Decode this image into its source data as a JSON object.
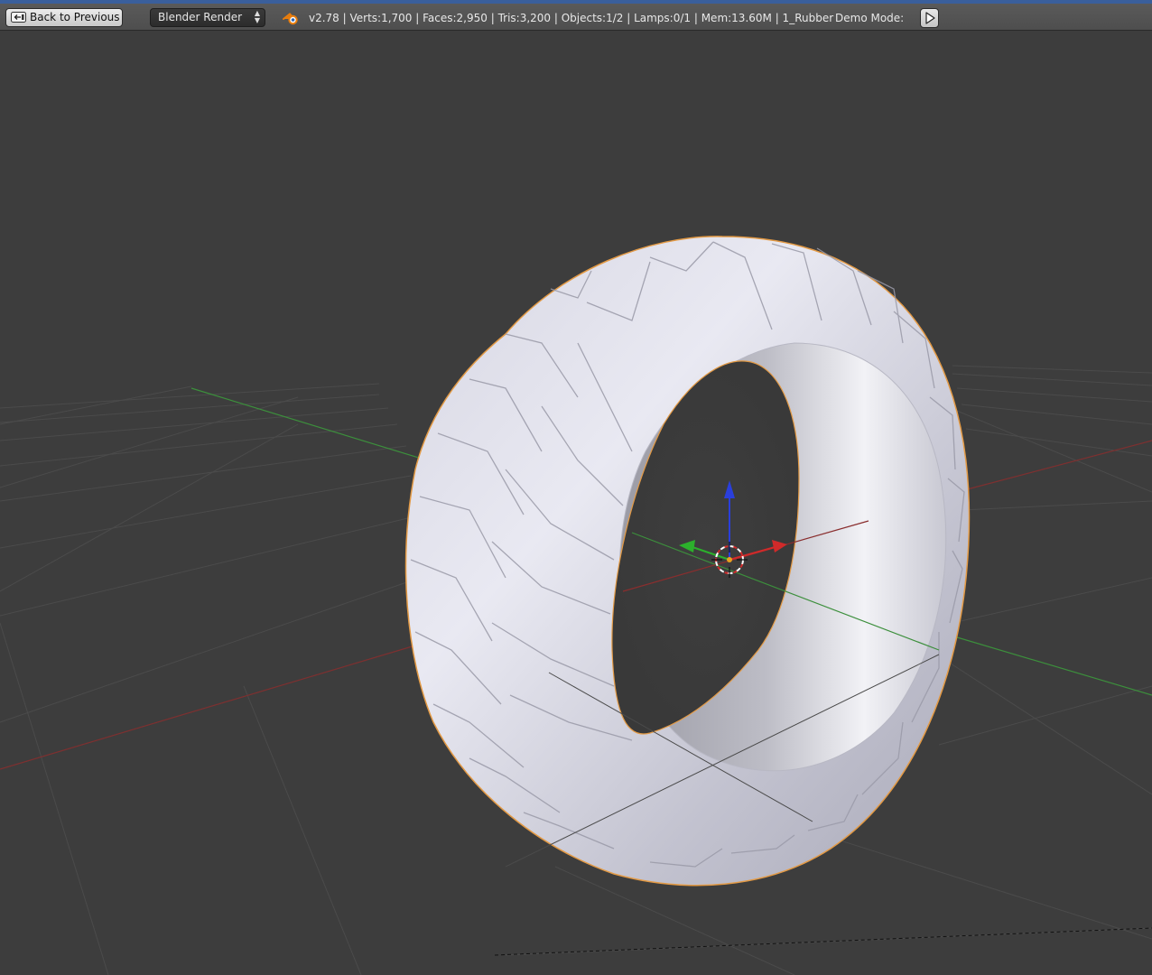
{
  "header": {
    "back_label": "Back to Previous",
    "engine": "Blender Render",
    "stats": "v2.78 | Verts:1,700 | Faces:2,950 | Tris:3,200 | Objects:1/2 | Lamps:0/1 | Mem:13.60M | 1_Rubber",
    "demo_mode_label": "Demo Mode:"
  },
  "icons": {
    "back": "back-arrow-icon",
    "engine_dropdown": "updown-arrows-icon",
    "logo": "blender-logo-icon",
    "play": "play-icon"
  },
  "colors": {
    "header_bg": "#555555",
    "viewport_bg": "#3d3d3d",
    "grid_line": "#4a4a4a",
    "axis_x": "#8c2c2c",
    "axis_y": "#3c8a3c",
    "axis_z": "#2a3fdc",
    "selection_outline": "#e39a45",
    "mesh_shade": "#c9c9d6"
  },
  "viewport": {
    "object": "tire mesh",
    "view": "perspective"
  }
}
